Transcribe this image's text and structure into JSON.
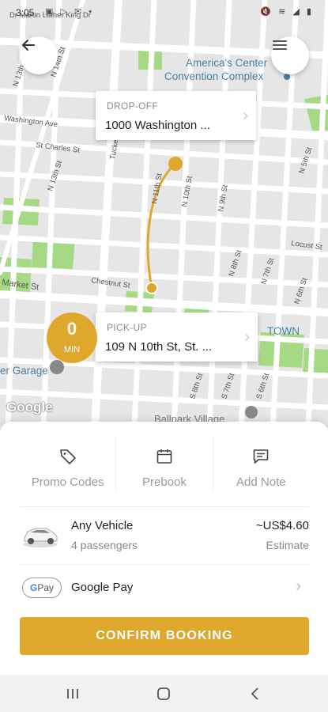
{
  "status_bar": {
    "time": "3:05",
    "left_icons": "▣ ▷ ✉ •",
    "right_icons": "🔇 ≋ ◢ ▮"
  },
  "map": {
    "labels": {
      "mlk": "Dr Martin Luther King Dr",
      "n14": "N 14th St",
      "n13": "N 13th St",
      "washington": "Washington Ave",
      "stcharles": "St Charles St",
      "n12": "N 12th St",
      "n11": "N 11th St",
      "n10": "N 10th St",
      "n9": "N 9th St",
      "n8": "N 8th St",
      "n7": "N 7th St",
      "n6": "N 6th St",
      "n5": "N 5th St",
      "tucker": "Tucker Blvd",
      "chestnut": "Chestnut St",
      "market": "Market St",
      "locust": "Locust St",
      "s8": "S 8th St",
      "s7": "S 7th St",
      "s6": "S 6th St",
      "america": "America's Center",
      "convention": "Convention Complex",
      "garage": "er Garage",
      "ballpark": "Ballpark Village",
      "town": "TOWN"
    },
    "google": "Google"
  },
  "dropoff": {
    "label": "DROP-OFF",
    "address": "1000 Washington ..."
  },
  "pickup": {
    "label": "PICK-UP",
    "address": "109 N 10th St, St. ..."
  },
  "eta": {
    "value": "0",
    "unit": "MIN"
  },
  "actions": [
    {
      "label": "Promo Codes",
      "icon": "tag-icon"
    },
    {
      "label": "Prebook",
      "icon": "calendar-icon"
    },
    {
      "label": "Add Note",
      "icon": "note-icon"
    }
  ],
  "vehicle": {
    "name": "Any Vehicle",
    "passengers": "4 passengers",
    "price": "~US$4.60",
    "price_label": "Estimate"
  },
  "payment": {
    "badge_g": "G",
    "badge_text": "Pay",
    "name": "Google Pay"
  },
  "confirm": "CONFIRM BOOKING",
  "colors": {
    "accent": "#e0a72d",
    "park": "#a6d984",
    "road": "#ffffff",
    "map_bg": "#e6e6e6"
  }
}
